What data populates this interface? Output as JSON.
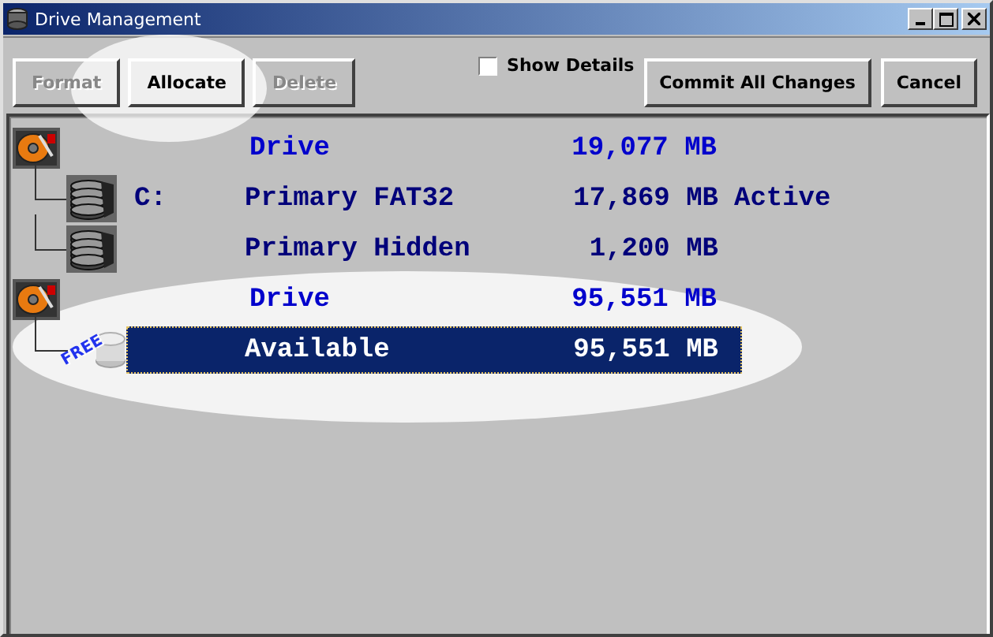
{
  "window": {
    "title": "Drive Management"
  },
  "toolbar": {
    "buttons": [
      {
        "label": "Format",
        "disabled": true
      },
      {
        "label": "Allocate",
        "disabled": false
      },
      {
        "label": "Delete",
        "disabled": true
      }
    ],
    "show_details": {
      "label": "Show Details",
      "checked": false
    },
    "actions": [
      {
        "label": "Commit All Changes"
      },
      {
        "label": "Cancel"
      }
    ]
  },
  "drives": [
    {
      "label": "Drive",
      "size": "19,077 MB",
      "children": [
        {
          "kind": "partition",
          "letter": "C:",
          "type": "Primary FAT32",
          "size": "17,869 MB",
          "status": "Active",
          "selected": false
        },
        {
          "kind": "partition",
          "type": "Primary Hidden",
          "size": "1,200 MB",
          "selected": false
        }
      ]
    },
    {
      "label": "Drive",
      "size": "95,551 MB",
      "children": [
        {
          "kind": "free",
          "badge": "FREE",
          "type": "Available",
          "size": "95,551 MB",
          "selected": true
        }
      ]
    }
  ]
}
